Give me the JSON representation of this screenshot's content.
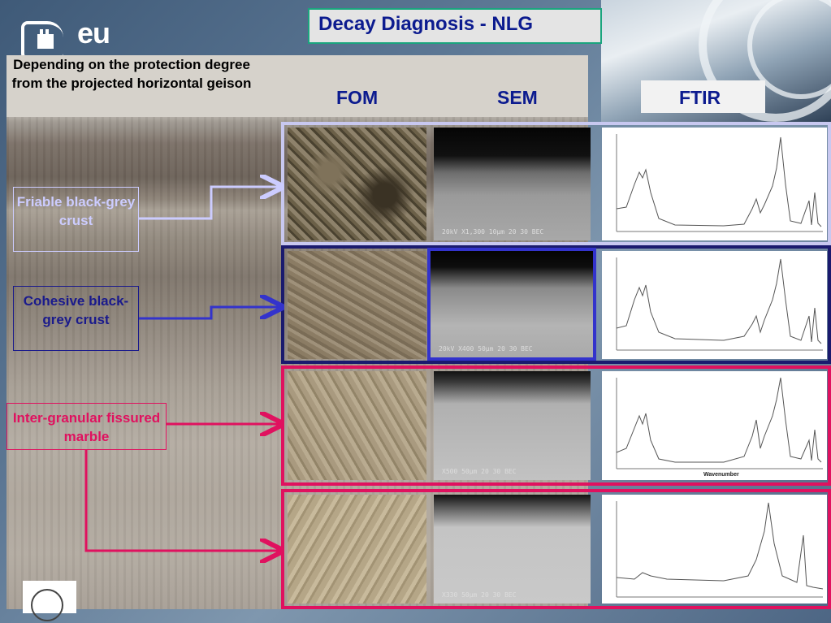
{
  "slide": {
    "title": "Decay Diagnosis - NLG",
    "subtitle": "Depending on the protection degree from the projected horizontal geison",
    "logo_text": "eu",
    "columns": {
      "fom": "FOM",
      "sem": "SEM",
      "ftir": "FTIR"
    }
  },
  "colors": {
    "title_border": "#1aa57e",
    "title_text": "#0c1b8f",
    "row1_frame": "#c8c8f0",
    "row2_frame": "#1a1a6e",
    "row2_accent": "#3333cc",
    "row3_frame": "#e0115f",
    "row4_frame": "#e0115f",
    "label1_text": "#ccccff",
    "label2_text": "#1a1a8c",
    "label3_text": "#e0115f"
  },
  "labels": [
    {
      "text": "Friable black-grey crust",
      "icon": "arrow-right-icon"
    },
    {
      "text": "Cohesive black-grey crust",
      "icon": "arrow-right-icon"
    },
    {
      "text": "Inter-granular fissured marble",
      "icon": "arrow-right-icon"
    }
  ],
  "sem_captions": [
    "20kV X1,300 10µm 20 30 BEC",
    "20kV X400 50µm 20 30 BEC",
    "X500 50µm 20 30 BEC",
    "X330 50µm 20 30 BEC"
  ],
  "ftir_axis": {
    "xlabel": "Wavenumber"
  }
}
